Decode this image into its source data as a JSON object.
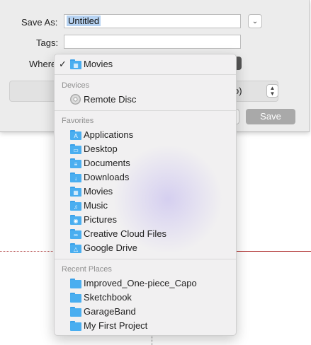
{
  "dialog": {
    "save_as_label": "Save As:",
    "save_as_value": "Untitled",
    "tags_label": "Tags:",
    "tags_value": "",
    "where_label": "Where",
    "format_value_fragment": "o)",
    "save_label": "Save"
  },
  "menu": {
    "current": {
      "label": "Movies",
      "icon": "film-folder-icon",
      "checked": true
    },
    "sections": {
      "devices": "Devices",
      "favorites": "Favorites",
      "recent": "Recent Places"
    },
    "devices": [
      {
        "label": "Remote Disc",
        "icon": "disc-icon"
      }
    ],
    "favorites": [
      {
        "label": "Applications",
        "icon": "applications-folder-icon",
        "glyph": "A"
      },
      {
        "label": "Desktop",
        "icon": "desktop-folder-icon",
        "glyph": "▭"
      },
      {
        "label": "Documents",
        "icon": "documents-folder-icon",
        "glyph": "≡"
      },
      {
        "label": "Downloads",
        "icon": "downloads-folder-icon",
        "glyph": "↓"
      },
      {
        "label": "Movies",
        "icon": "movies-folder-icon",
        "glyph": "▦"
      },
      {
        "label": "Music",
        "icon": "music-folder-icon",
        "glyph": "♫"
      },
      {
        "label": "Pictures",
        "icon": "pictures-folder-icon",
        "glyph": "◉"
      },
      {
        "label": "Creative Cloud Files",
        "icon": "creative-cloud-folder-icon",
        "glyph": "∞"
      },
      {
        "label": "Google Drive",
        "icon": "google-drive-folder-icon",
        "glyph": "△"
      }
    ],
    "recent": [
      {
        "label": "Improved_One-piece_Capo",
        "icon": "folder-icon"
      },
      {
        "label": "Sketchbook",
        "icon": "folder-icon"
      },
      {
        "label": "GarageBand",
        "icon": "folder-icon"
      },
      {
        "label": "My First Project",
        "icon": "folder-icon"
      }
    ]
  },
  "colors": {
    "folder": "#4aaef0",
    "selection": "#b7d3f2",
    "save_button": "#a9a9a9"
  }
}
